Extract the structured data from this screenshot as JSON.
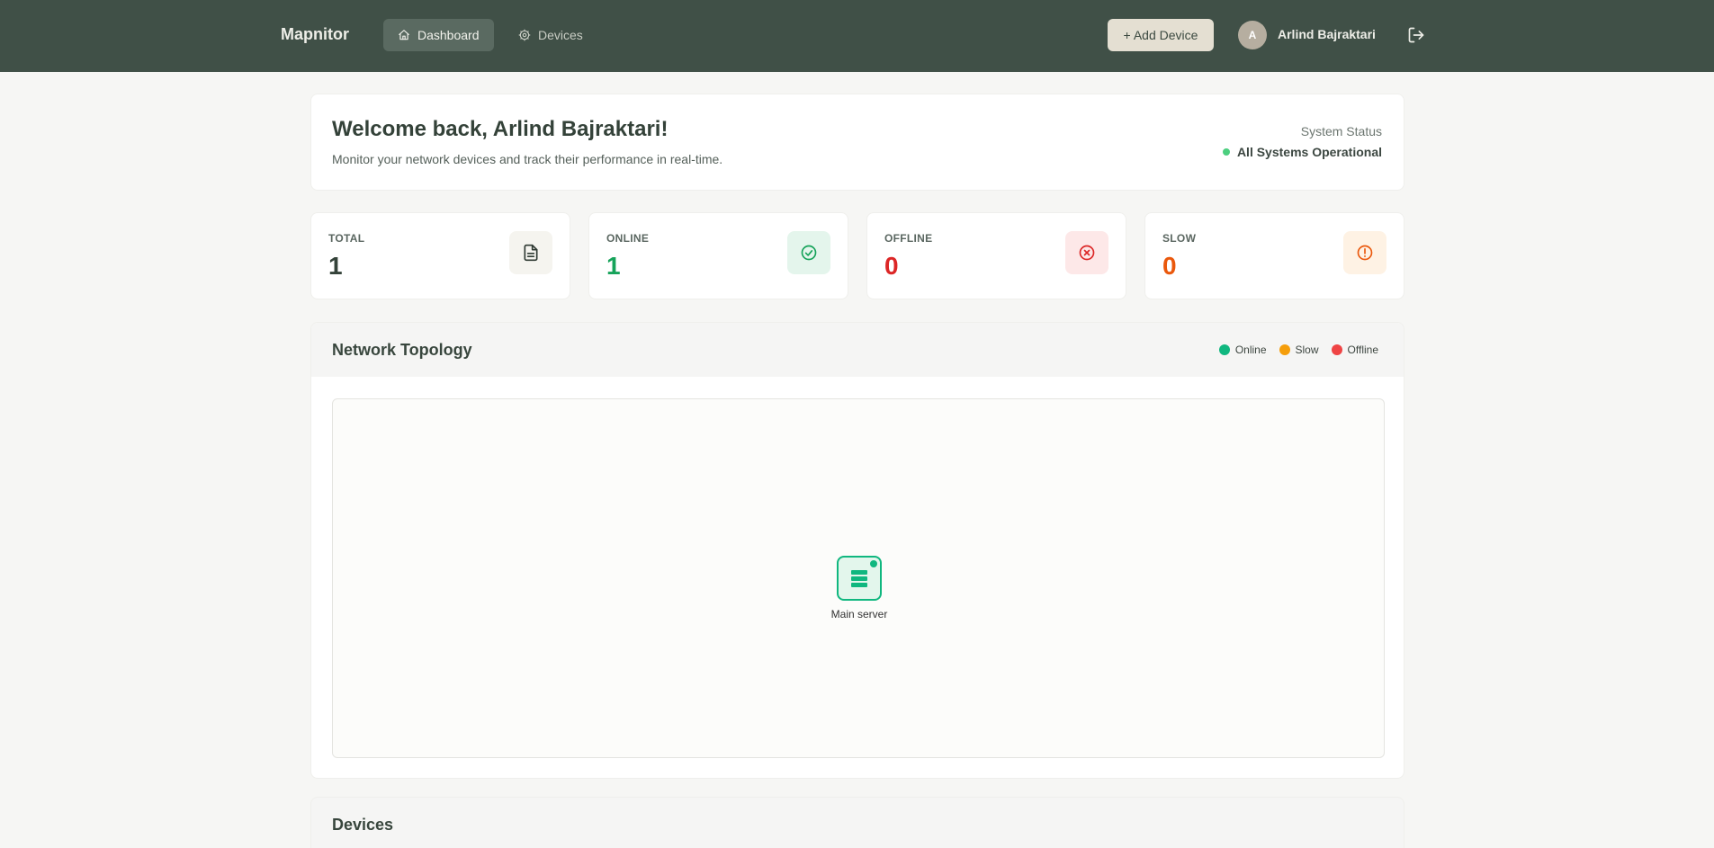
{
  "app": {
    "name": "Mapnitor"
  },
  "nav": {
    "dashboard_label": "Dashboard",
    "devices_label": "Devices",
    "add_device_label": "+ Add Device",
    "user_initial": "A",
    "user_name": "Arlind Bajraktari"
  },
  "welcome": {
    "title": "Welcome back, Arlind Bajraktari!",
    "subtitle": "Monitor your network devices and track their performance in real-time.",
    "status_label": "System Status",
    "status_value": "All Systems Operational"
  },
  "stats": {
    "total": {
      "label": "TOTAL",
      "value": "1",
      "color": "#344239"
    },
    "online": {
      "label": "ONLINE",
      "value": "1",
      "color": "#16a35a"
    },
    "offline": {
      "label": "OFFLINE",
      "value": "0",
      "color": "#dc2626"
    },
    "slow": {
      "label": "SLOW",
      "value": "0",
      "color": "#ea580c"
    }
  },
  "topology": {
    "title": "Network Topology",
    "legend": {
      "online": {
        "label": "Online",
        "color": "#10b77f"
      },
      "slow": {
        "label": "Slow",
        "color": "#f59e0b"
      },
      "offline": {
        "label": "Offline",
        "color": "#ef4444"
      }
    },
    "nodes": [
      {
        "label": "Main server",
        "status": "online",
        "icon": "server-icon"
      }
    ]
  },
  "devices": {
    "title": "Devices"
  }
}
